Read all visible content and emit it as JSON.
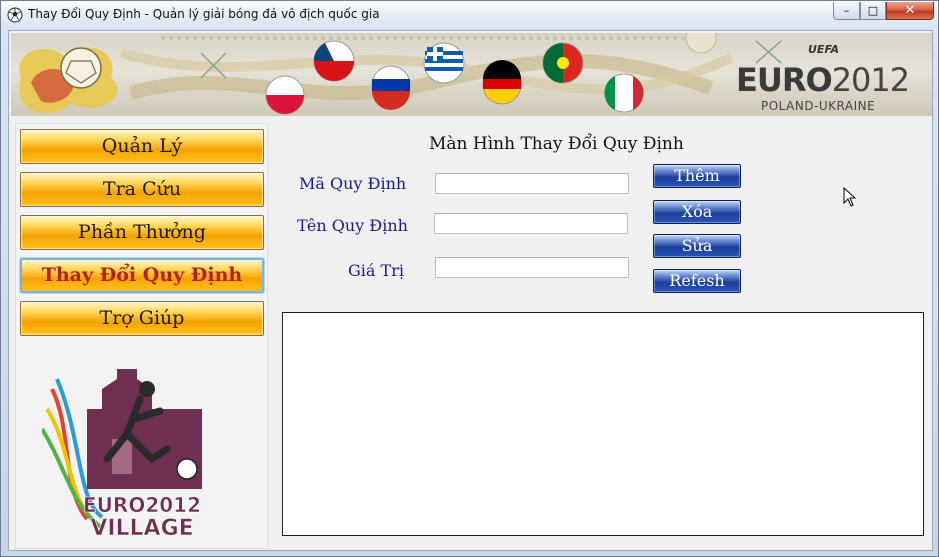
{
  "window": {
    "title": "Thay Đổi Quy Định - Quản lý giải bóng đá vô địch quốc gia",
    "minimize_glyph": "–",
    "maximize_glyph": "□",
    "close_glyph": "✕"
  },
  "banner": {
    "uefa": "UEFA",
    "euro": "EURO",
    "year": "2012",
    "subtitle": "POLAND-UKRAINE"
  },
  "menu": {
    "items": [
      {
        "label": "Quản Lý"
      },
      {
        "label": "Tra Cứu"
      },
      {
        "label": "Phần Thưởng"
      },
      {
        "label": "Thay Đổi Quy Định"
      },
      {
        "label": "Trợ Giúp"
      }
    ],
    "active_index": 3
  },
  "village_logo": {
    "line1": "EURO2012",
    "line2": "VILLAGE"
  },
  "form": {
    "screen_title": "Màn Hình Thay Đổi Quy Định",
    "fields": [
      {
        "label": "Mã Quy Định",
        "value": ""
      },
      {
        "label": "Tên Quy Định",
        "value": ""
      },
      {
        "label": "Giá Trị",
        "value": ""
      }
    ],
    "buttons": {
      "add": "Thêm",
      "delete": "Xóa",
      "edit": "Sửa",
      "refresh": "Refesh"
    }
  },
  "colors": {
    "menu_gradient": "#f5a300",
    "active_menu_text": "#b32020",
    "label_text": "#1b1b8f",
    "action_button": "#1d3f9b"
  }
}
